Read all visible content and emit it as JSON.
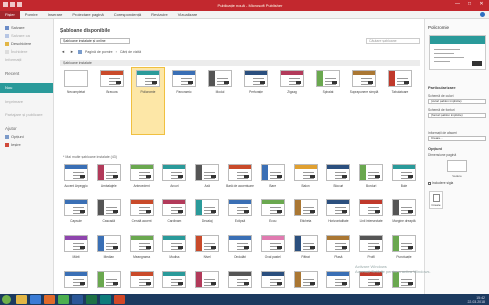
{
  "window": {
    "title": "Publicație nouă - Microsoft Publisher",
    "controls": [
      "—",
      "□",
      "✕"
    ]
  },
  "ribbon": {
    "file_tab": "Fișier",
    "tabs": [
      "Pornire",
      "Inserare",
      "Proiectare pagină",
      "Corespondență",
      "Revizuire",
      "Vizualizare"
    ]
  },
  "backstage": {
    "items": [
      {
        "label": "Salvare",
        "faded": false
      },
      {
        "label": "Salvare ca",
        "faded": true
      },
      {
        "label": "Deschidere",
        "faded": false
      },
      {
        "label": "Închidere",
        "faded": true
      }
    ],
    "info_label": "Informații",
    "recent_label": "Recent",
    "new_label": "Nou",
    "print_label": "Imprimare",
    "share_label": "Partajare și publicare",
    "help_label": "Ajutor",
    "options_label": "Opțiuni",
    "exit_label": "Ieșire"
  },
  "main": {
    "heading": "Șabloane disponibile",
    "select_value": "Șabloane instalate și online",
    "search_placeholder": "Căutare șabloane",
    "nav": {
      "back": "◄",
      "forward": "►",
      "home": "Pagină de pornire",
      "sep": "›",
      "current": "Cărți de vizită"
    },
    "section_installed": "Șabloane instalate",
    "section_more": "* Mai multe șabloane instalate (43)",
    "row1": [
      {
        "label": "Necompletat",
        "color": "",
        "style": "blank"
      },
      {
        "label": "Bravura",
        "color": "#c94a2a",
        "style": "bar"
      },
      {
        "label": "Policromie",
        "color": "#2a9a9a",
        "style": "bar",
        "selected": true
      },
      {
        "label": "Panoramic",
        "color": "#3a6fb5",
        "style": "bar"
      },
      {
        "label": "Modul",
        "color": "#555555",
        "style": "side"
      },
      {
        "label": "Perforație",
        "color": "#2b4f7e",
        "style": "bar"
      },
      {
        "label": "Zigzag",
        "color": "#b23a5a",
        "style": "bar"
      },
      {
        "label": "Spiralat",
        "color": "#6aa84f",
        "style": "side"
      },
      {
        "label": "Suprapunere simplă",
        "color": "#aa7733",
        "style": "bar"
      },
      {
        "label": "Tabulatoare",
        "color": "#c0392b",
        "style": "side"
      }
    ],
    "row2": [
      {
        "label": "Accent Arpeggio",
        "color": "#3a6fb5",
        "style": "bar"
      },
      {
        "label": "Ambalajele",
        "color": "#b23a5a",
        "style": "side"
      },
      {
        "label": "Antecedent",
        "color": "#6aa84f",
        "style": "bar"
      },
      {
        "label": "Arcuri",
        "color": "#2a9a9a",
        "style": "bar"
      },
      {
        "label": "Axă",
        "color": "#555555",
        "style": "side"
      },
      {
        "label": "Bară de accentuare",
        "color": "#c94a2a",
        "style": "bar"
      },
      {
        "label": "Bare",
        "color": "#3a6fb5",
        "style": "side"
      },
      {
        "label": "Balon",
        "color": "#e0a030",
        "style": "bar"
      },
      {
        "label": "Blocuri",
        "color": "#2b4f7e",
        "style": "bar"
      },
      {
        "label": "Borduri",
        "color": "#6aa84f",
        "style": "side"
      },
      {
        "label": "Bule",
        "color": "#2a9a9a",
        "style": "bar"
      }
    ],
    "row3": [
      {
        "label": "Capsule",
        "color": "#3a6fb5",
        "style": "bar"
      },
      {
        "label": "Cascadă",
        "color": "#555555",
        "style": "side"
      },
      {
        "label": "Cerută accent",
        "color": "#c94a2a",
        "style": "bar"
      },
      {
        "label": "Cardinam",
        "color": "#b23a5a",
        "style": "bar"
      },
      {
        "label": "Decalaj",
        "color": "#2a9a9a",
        "style": "side"
      },
      {
        "label": "Eclipsă",
        "color": "#3a6fb5",
        "style": "bar"
      },
      {
        "label": "Ecou",
        "color": "#6aa84f",
        "style": "bar"
      },
      {
        "label": "Eticheta",
        "color": "#aa7733",
        "style": "side"
      },
      {
        "label": "Horizontalitate",
        "color": "#2b4f7e",
        "style": "bar"
      },
      {
        "label": "Linii intersectate",
        "color": "#c0392b",
        "style": "bar"
      },
      {
        "label": "Margine dreaptă",
        "color": "#555555",
        "style": "side"
      }
    ],
    "row4": [
      {
        "label": "Mărit",
        "color": "#8e44ad",
        "style": "bar"
      },
      {
        "label": "Median",
        "color": "#3a6fb5",
        "style": "side"
      },
      {
        "label": "Meangrama",
        "color": "#6aa84f",
        "style": "bar"
      },
      {
        "label": "Modiss",
        "color": "#2a9a9a",
        "style": "bar"
      },
      {
        "label": "Nivel",
        "color": "#c94a2a",
        "style": "side"
      },
      {
        "label": "Ondulări",
        "color": "#3a6fb5",
        "style": "bar"
      },
      {
        "label": "Oval pastel",
        "color": "#e07ab0",
        "style": "bar"
      },
      {
        "label": "Pătrat",
        "color": "#2b4f7e",
        "style": "side"
      },
      {
        "label": "Plasă",
        "color": "#aa7733",
        "style": "bar"
      },
      {
        "label": "Profil",
        "color": "#555555",
        "style": "bar"
      },
      {
        "label": "Punctuație",
        "color": "#6aa84f",
        "style": "side"
      }
    ],
    "row5": [
      {
        "label": "",
        "color": "#3a6fb5",
        "style": "bar"
      },
      {
        "label": "",
        "color": "#6aa84f",
        "style": "side"
      },
      {
        "label": "",
        "color": "#c94a2a",
        "style": "bar"
      },
      {
        "label": "",
        "color": "#2a9a9a",
        "style": "bar"
      },
      {
        "label": "",
        "color": "#b23a5a",
        "style": "side"
      },
      {
        "label": "",
        "color": "#555555",
        "style": "bar"
      },
      {
        "label": "",
        "color": "#2b4f7e",
        "style": "bar"
      },
      {
        "label": "",
        "color": "#aa7733",
        "style": "side"
      },
      {
        "label": "",
        "color": "#3a6fb5",
        "style": "bar"
      },
      {
        "label": "",
        "color": "#c0392b",
        "style": "bar"
      },
      {
        "label": "",
        "color": "#6aa84f",
        "style": "side"
      }
    ]
  },
  "right_panel": {
    "title": "Policromie",
    "customize_header": "Particularizare",
    "color_scheme_label": "Schemă de culori",
    "color_scheme_value": "(culori șablon implicite)",
    "font_scheme_label": "Schemă de fonturi",
    "font_scheme_value": "(fonturi șablon implicite)",
    "business_info_label": "Informații de afaceri",
    "business_info_value": "Creare...",
    "options_header": "Opțiuni",
    "page_size_label": "Dimensiune pagină",
    "page_orientation": "Vedere",
    "include_logo_label": "Includere sigla",
    "create_label": "Creare"
  },
  "watermark": {
    "line1": "Activare Windows",
    "line2": "Accesați Setările pentru a activa Windows."
  },
  "taskbar": {
    "time": "15:42",
    "date": "22.03.2018"
  },
  "colors": {
    "title_bar": "#c2282e",
    "file_tab": "#a4262c",
    "accent": "#2a9a9a",
    "selection": "#fde7a7",
    "taskbar": "#1c3a5f"
  }
}
